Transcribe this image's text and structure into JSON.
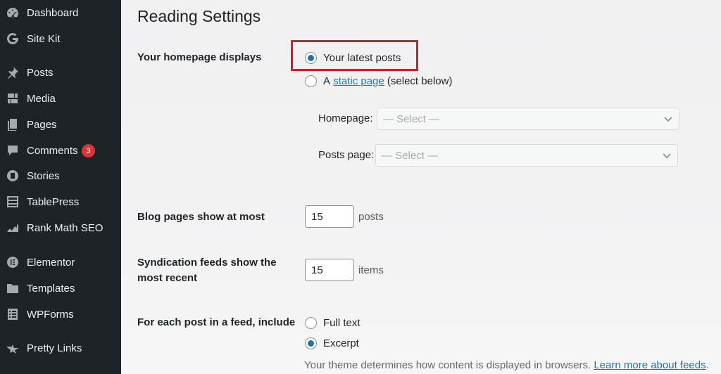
{
  "sidebar": {
    "items": [
      {
        "label": "Dashboard",
        "icon": "dashboard-icon"
      },
      {
        "label": "Site Kit",
        "icon": "sitekit-g-icon"
      },
      {
        "label": "Posts",
        "icon": "pin-icon"
      },
      {
        "label": "Media",
        "icon": "media-icon"
      },
      {
        "label": "Pages",
        "icon": "pages-icon"
      },
      {
        "label": "Comments",
        "icon": "comment-icon",
        "badge": "3"
      },
      {
        "label": "Stories",
        "icon": "stories-icon"
      },
      {
        "label": "TablePress",
        "icon": "table-icon"
      },
      {
        "label": "Rank Math SEO",
        "icon": "rankmath-icon"
      },
      {
        "label": "Elementor",
        "icon": "elementor-icon"
      },
      {
        "label": "Templates",
        "icon": "folder-icon"
      },
      {
        "label": "WPForms",
        "icon": "forms-icon"
      },
      {
        "label": "Pretty Links",
        "icon": "star-icon"
      }
    ]
  },
  "main": {
    "title": "Reading Settings",
    "homepage_displays": {
      "label": "Your homepage displays",
      "option_latest": "Your latest posts",
      "option_static_prefix": "A",
      "option_static_link": "static page",
      "option_static_suffix": "(select below)",
      "selected": "latest",
      "homepage_label": "Homepage:",
      "homepage_select": "— Select —",
      "posts_page_label": "Posts page:",
      "posts_page_select": "— Select —"
    },
    "blog_pages": {
      "label": "Blog pages show at most",
      "value": "15",
      "unit": "posts"
    },
    "syndication": {
      "label_line1": "Syndication feeds show the",
      "label_line2": "most recent",
      "value": "15",
      "unit": "items"
    },
    "feed_include": {
      "label": "For each post in a feed, include",
      "option_full": "Full text",
      "option_excerpt": "Excerpt",
      "selected": "excerpt",
      "description": "Your theme determines how content is displayed in browsers.",
      "description_link": "Learn more about feeds"
    }
  },
  "colors": {
    "sidebar_bg": "#1d2327",
    "accent": "#2271b1",
    "highlight": "#c8232c",
    "badge": "#d63638"
  }
}
